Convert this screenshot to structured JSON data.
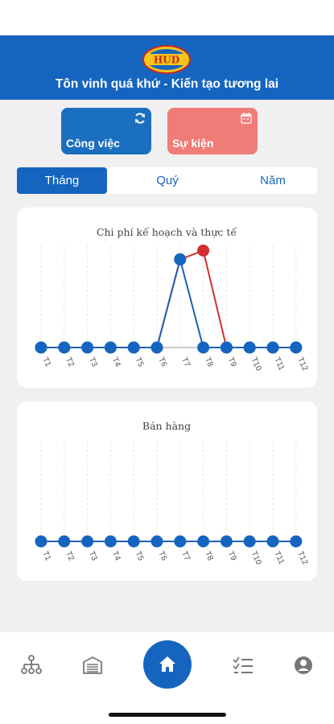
{
  "header": {
    "logo_text": "HUD",
    "title": "Tôn vinh quá khứ - Kiến tạo tương lai"
  },
  "tiles": [
    {
      "label": "Công việc",
      "icon": "refresh-icon",
      "color": "#1b6fc0"
    },
    {
      "label": "Sự kiện",
      "icon": "calendar-icon",
      "color": "#f07c77"
    }
  ],
  "period_tabs": {
    "items": [
      "Tháng",
      "Quý",
      "Năm"
    ],
    "selected": "Tháng"
  },
  "colors": {
    "primary": "#1565c0",
    "plan_line": "#1f5fb4",
    "actual_line": "#d32f2f",
    "point": "#1565c0"
  },
  "chart_data": [
    {
      "type": "line",
      "title": "Chi phí kế hoạch và thực tế",
      "categories": [
        "T1",
        "T2",
        "T3",
        "T4",
        "T5",
        "T6",
        "T7",
        "T8",
        "T9",
        "T10",
        "T11",
        "T12"
      ],
      "series": [
        {
          "values": [
            0,
            0,
            0,
            0,
            0,
            0,
            1,
            0,
            0,
            0,
            0,
            0
          ]
        },
        {
          "values": [
            0,
            0,
            0,
            0,
            0,
            0,
            1,
            1.1,
            0,
            0,
            0,
            0
          ]
        }
      ],
      "ylim": [
        0,
        1.15
      ],
      "grid": true
    },
    {
      "type": "line",
      "title": "Bán hàng",
      "categories": [
        "T1",
        "T2",
        "T3",
        "T4",
        "T5",
        "T6",
        "T7",
        "T8",
        "T9",
        "T10",
        "T11",
        "T12"
      ],
      "series": [
        {
          "values": [
            0,
            0,
            0,
            0,
            0,
            0,
            0,
            0,
            0,
            0,
            0,
            0
          ]
        }
      ],
      "grid": true
    }
  ],
  "bottom_nav": {
    "items": [
      "org-chart-icon",
      "warehouse-icon",
      "home-icon",
      "checklist-icon",
      "account-icon"
    ]
  }
}
